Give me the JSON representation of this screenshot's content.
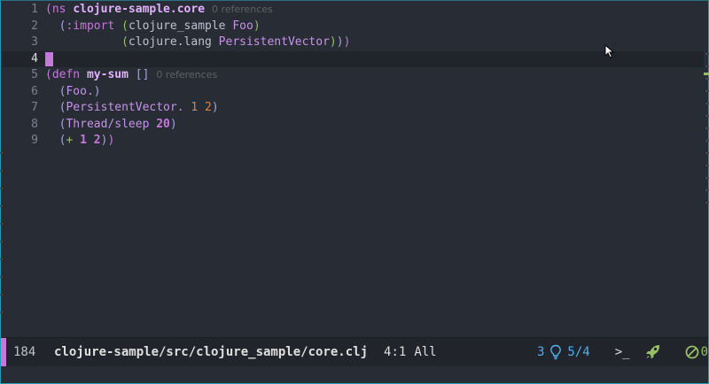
{
  "editor": {
    "lines": [
      {
        "num": "1",
        "segments": [
          {
            "t": "(",
            "c": "p"
          },
          {
            "t": "ns ",
            "c": "kw"
          },
          {
            "t": "clojure-sample.core",
            "c": "def"
          },
          {
            "t": "0 references",
            "c": "ref"
          }
        ]
      },
      {
        "num": "2",
        "segments": [
          {
            "t": "  ",
            "c": "sym"
          },
          {
            "t": "(",
            "c": "p2"
          },
          {
            "t": ":import ",
            "c": "kw"
          },
          {
            "t": "(",
            "c": "green"
          },
          {
            "t": "clojure_sample ",
            "c": "sym"
          },
          {
            "t": "Foo",
            "c": "type"
          },
          {
            "t": ")",
            "c": "green"
          }
        ]
      },
      {
        "num": "3",
        "segments": [
          {
            "t": "           ",
            "c": "sym"
          },
          {
            "t": "(",
            "c": "green"
          },
          {
            "t": "clojure.lang ",
            "c": "sym"
          },
          {
            "t": "PersistentVector",
            "c": "type"
          },
          {
            "t": ")",
            "c": "green"
          },
          {
            "t": ")",
            "c": "p2"
          },
          {
            "t": ")",
            "c": "p"
          }
        ]
      },
      {
        "num": "4",
        "segments": [],
        "current": true
      },
      {
        "num": "5",
        "segments": [
          {
            "t": "(",
            "c": "p"
          },
          {
            "t": "defn ",
            "c": "kw"
          },
          {
            "t": "my-sum ",
            "c": "def"
          },
          {
            "t": "[]",
            "c": "p2"
          },
          {
            "t": "0 references",
            "c": "ref"
          }
        ]
      },
      {
        "num": "6",
        "segments": [
          {
            "t": "  ",
            "c": "sym"
          },
          {
            "t": "(",
            "c": "p2"
          },
          {
            "t": "Foo.",
            "c": "type"
          },
          {
            "t": ")",
            "c": "p2"
          }
        ]
      },
      {
        "num": "7",
        "segments": [
          {
            "t": "  ",
            "c": "sym"
          },
          {
            "t": "(",
            "c": "p2"
          },
          {
            "t": "PersistentVector. ",
            "c": "type"
          },
          {
            "t": "1 2",
            "c": "num"
          },
          {
            "t": ")",
            "c": "p2"
          }
        ]
      },
      {
        "num": "8",
        "segments": [
          {
            "t": "  ",
            "c": "sym"
          },
          {
            "t": "(",
            "c": "p2"
          },
          {
            "t": "Thread/sleep ",
            "c": "type"
          },
          {
            "t": "20",
            "c": "numb"
          },
          {
            "t": ")",
            "c": "p2"
          }
        ]
      },
      {
        "num": "9",
        "segments": [
          {
            "t": "  ",
            "c": "sym"
          },
          {
            "t": "(",
            "c": "p2"
          },
          {
            "t": "+ ",
            "c": "green"
          },
          {
            "t": "1 2",
            "c": "numb"
          },
          {
            "t": ")",
            "c": "p2"
          },
          {
            "t": ")",
            "c": "p"
          }
        ]
      }
    ]
  },
  "statusbar": {
    "line_count": "184",
    "file_path": "clojure-sample/src/clojure_sample/core.clj",
    "position": "4:1",
    "scroll": "All",
    "lsp_count": "3",
    "ratio": "5/4",
    "terminal": ">_",
    "error_count": "0"
  },
  "icons": {
    "mouse_pointer": "mouse-pointer-icon",
    "lightbulb": "lightbulb-icon",
    "rocket": "rocket-icon",
    "no_errors": "no-errors-icon"
  },
  "colors": {
    "background": "#282c34",
    "current_line": "#21252b",
    "accent": "#c678dd",
    "info_blue": "#51afef",
    "ok_green": "#98be65"
  }
}
